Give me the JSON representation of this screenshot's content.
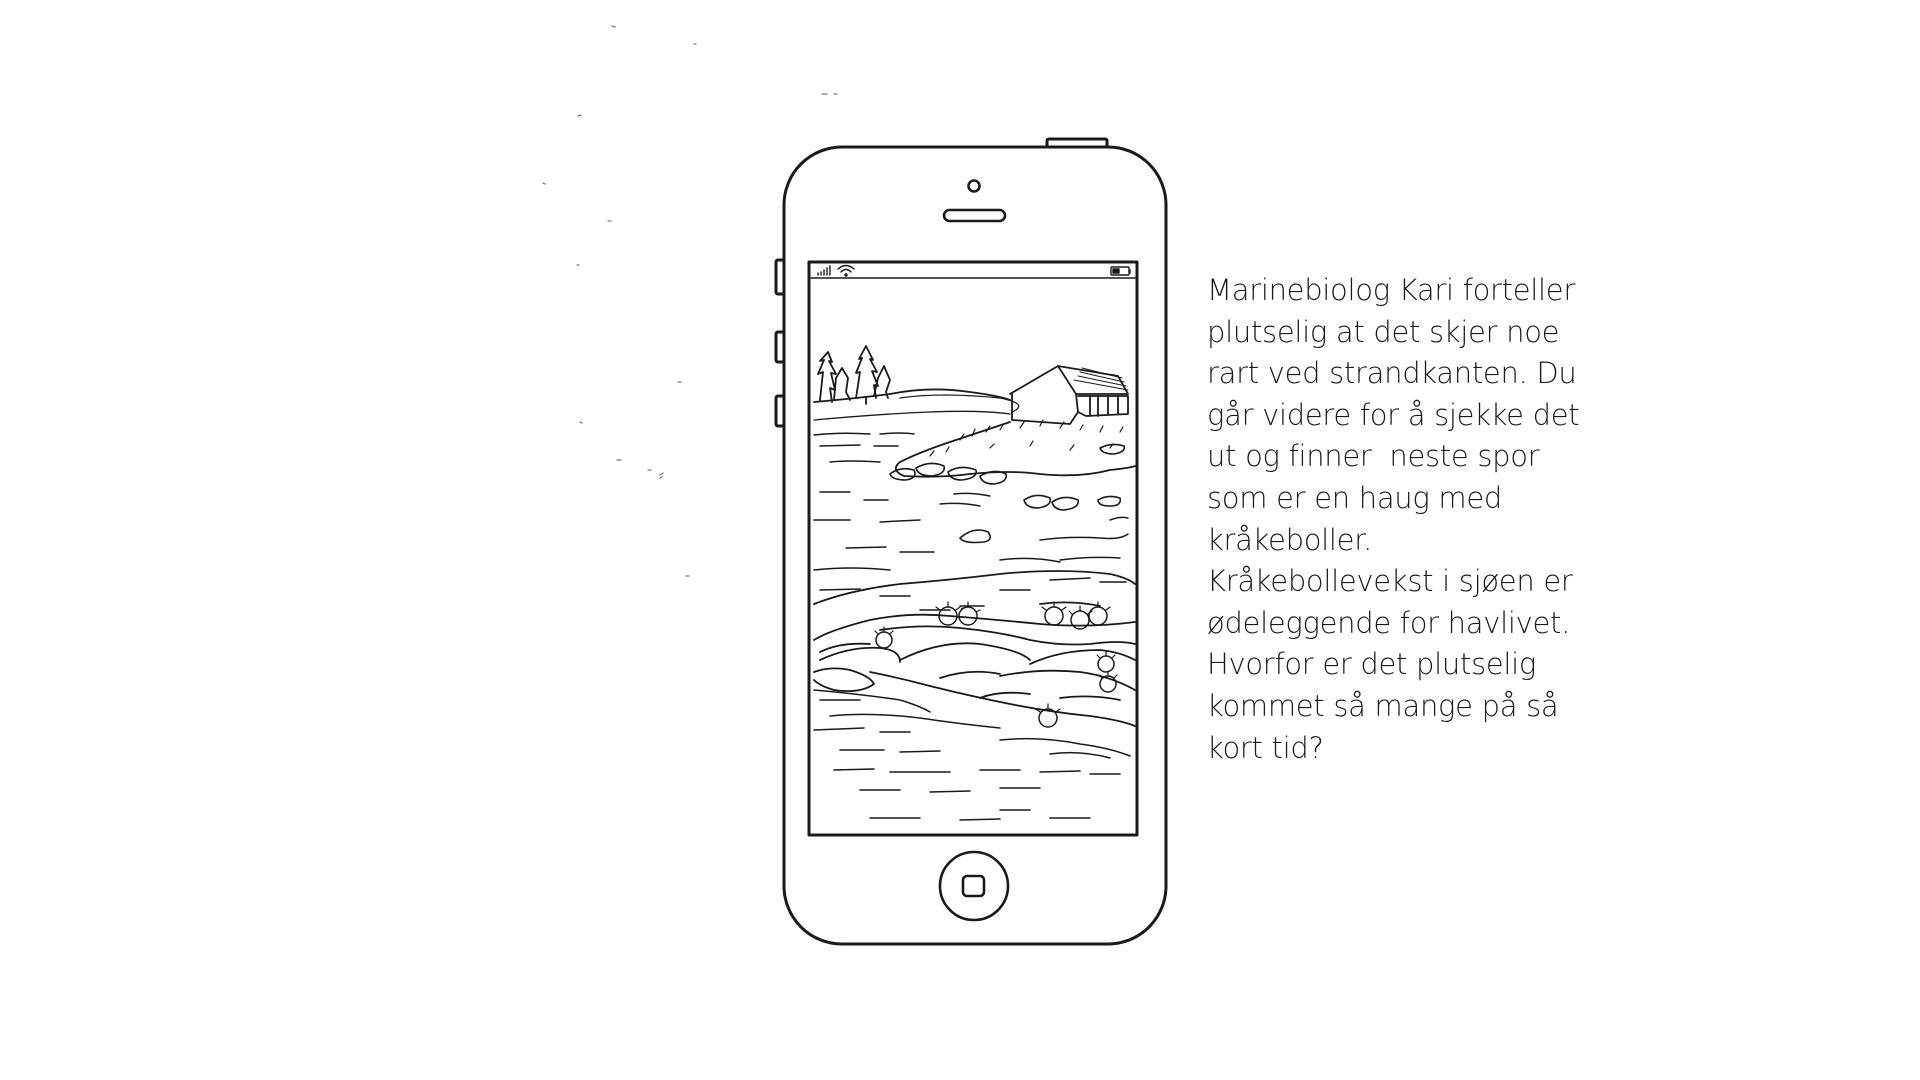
{
  "story": {
    "lines": [
      "Marinebiolog Kari forteller",
      "plutselig at det skjer noe",
      "rart ved strandkanten. Du",
      "går videre for å sjekke det",
      "ut og finner  neste spor",
      "som er en haug med",
      "kråkeboller.",
      "Kråkebollevekst i sjøen er",
      "ødeleggende for havlivet.",
      "Hvorfor er det plutselig",
      "kommet så mange på så",
      "kort tid?"
    ]
  },
  "illustration": {
    "device": "smartphone",
    "screen_scene": "coastal landscape with boathouse, trees, rocks and sea urchins at the shoreline",
    "status_bar_icons": [
      "signal-icon",
      "wifi-icon",
      "battery-icon"
    ]
  },
  "colors": {
    "background": "#ffffff",
    "ink": "#1a1a1a"
  }
}
